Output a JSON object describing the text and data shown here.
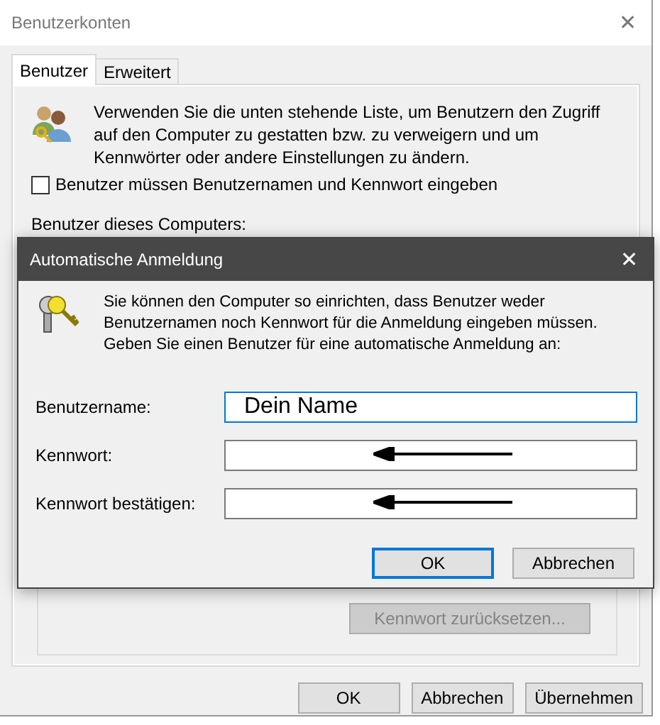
{
  "window": {
    "title": "Benutzerkonten"
  },
  "tabs": [
    {
      "label": "Benutzer",
      "selected": true
    },
    {
      "label": "Erweitert",
      "selected": false
    }
  ],
  "intro": "Verwenden Sie die unten stehende Liste, um Benutzern den Zugriff auf den Computer zu gestatten bzw. zu verweigern und um Kennwörter oder andere Einstellungen zu ändern.",
  "require_login": {
    "label": "Benutzer müssen Benutzernamen und Kennwort eingeben",
    "checked": false
  },
  "users_label": "Benutzer dieses Computers:",
  "reset_button": {
    "label": "Kennwort zurücksetzen...",
    "disabled": true
  },
  "buttons": [
    {
      "label": "OK"
    },
    {
      "label": "Abbrechen"
    },
    {
      "label": "Übernehmen"
    }
  ],
  "dialog": {
    "title": "Automatische Anmeldung",
    "close": "✕",
    "text": "Sie können den Computer so einrichten, dass Benutzer weder Benutzernamen noch Kennwort für die Anmeldung eingeben müssen. Geben Sie einen Benutzer für eine automatische Anmeldung an:",
    "fields": [
      {
        "label": "Benutzername:",
        "value": "Dein Name",
        "focused": true,
        "arrow": false
      },
      {
        "label": "Kennwort:",
        "focused": false,
        "arrow": true
      },
      {
        "label": "Kennwort bestätigen:",
        "focused": false,
        "arrow": true
      }
    ],
    "buttons": [
      {
        "label": "OK",
        "default": true
      },
      {
        "label": "Abbrechen",
        "default": false
      }
    ]
  }
}
